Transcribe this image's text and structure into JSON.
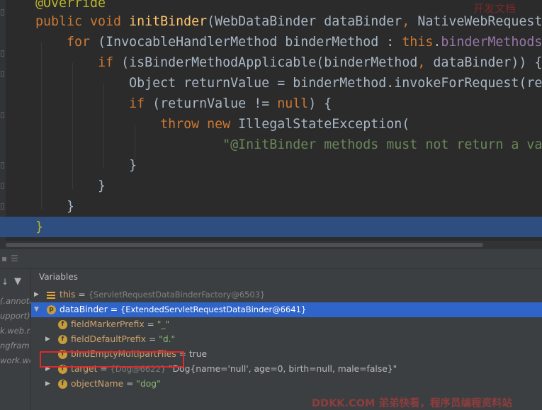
{
  "editor": {
    "lines": [
      {
        "segments": [
          {
            "t": "@Override",
            "c": "ann"
          }
        ]
      },
      {
        "segments": [
          {
            "t": "public void ",
            "c": "kw"
          },
          {
            "t": "initBinder",
            "c": "fn"
          },
          {
            "t": "(WebDataBinder dataBinder",
            "c": ""
          },
          {
            "t": ", ",
            "c": "kw"
          },
          {
            "t": "NativeWebRequest",
            "c": ""
          }
        ]
      },
      {
        "segments": [
          {
            "t": "    ",
            "c": ""
          },
          {
            "t": "for ",
            "c": "kw"
          },
          {
            "t": "(InvocableHandlerMethod binderMethod : ",
            "c": ""
          },
          {
            "t": "this",
            "c": "kw"
          },
          {
            "t": ".",
            "c": ""
          },
          {
            "t": "binderMethods",
            "c": "fld"
          }
        ]
      },
      {
        "segments": [
          {
            "t": "        ",
            "c": ""
          },
          {
            "t": "if ",
            "c": "kw"
          },
          {
            "t": "(isBinderMethodApplicable(binderMethod",
            "c": ""
          },
          {
            "t": ", ",
            "c": "kw"
          },
          {
            "t": "dataBinder)) {",
            "c": ""
          }
        ]
      },
      {
        "segments": [
          {
            "t": "            Object returnValue = binderMethod.invokeForRequest(re",
            "c": ""
          }
        ]
      },
      {
        "segments": [
          {
            "t": "            ",
            "c": ""
          },
          {
            "t": "if ",
            "c": "kw"
          },
          {
            "t": "(returnValue != ",
            "c": ""
          },
          {
            "t": "null",
            "c": "kw"
          },
          {
            "t": ") {",
            "c": ""
          }
        ]
      },
      {
        "segments": [
          {
            "t": "                ",
            "c": ""
          },
          {
            "t": "throw new ",
            "c": "kw"
          },
          {
            "t": "IllegalStateException(",
            "c": ""
          }
        ]
      },
      {
        "segments": [
          {
            "t": "                        ",
            "c": ""
          },
          {
            "t": "\"@InitBinder methods must not return a va",
            "c": "str"
          }
        ]
      },
      {
        "segments": [
          {
            "t": "            }",
            "c": ""
          }
        ]
      },
      {
        "segments": [
          {
            "t": "        }",
            "c": ""
          }
        ]
      },
      {
        "segments": [
          {
            "t": "    }",
            "c": ""
          }
        ]
      },
      {
        "segments": [
          {
            "t": "}",
            "c": "ann"
          }
        ]
      }
    ]
  },
  "debugger": {
    "variables_label": "Variables",
    "frames": [
      "(.annota",
      "upport)",
      "k.web.n",
      "ngfram",
      "work.we",
      ""
    ],
    "variables": [
      {
        "toggle": "▶",
        "icon": "list",
        "name": "this",
        "eq": " = ",
        "type": "{ServletRequestDataBinderFactory@6503}",
        "value": ""
      },
      {
        "toggle": "▼",
        "icon": "p",
        "name": "dataBinder",
        "eq": " = ",
        "type": "{ExtendedServletRequestDataBinder@6641}",
        "value": ""
      },
      {
        "toggle": "",
        "icon": "f",
        "name": "fieldMarkerPrefix",
        "eq": " = ",
        "type": "",
        "value": "\"_\""
      },
      {
        "toggle": "▶",
        "icon": "f",
        "name": "fieldDefaultPrefix",
        "eq": " = ",
        "type": "",
        "value": "\"d.\""
      },
      {
        "toggle": "",
        "icon": "f",
        "name": "bindEmptyMultipartFiles",
        "eq": " = ",
        "type": "",
        "value": "true"
      },
      {
        "toggle": "▶",
        "icon": "f",
        "name": "target",
        "eq": " = ",
        "type": "{Dog@6622}",
        "value": " \"Dog{name='null', age=0, birth=null, male=false}\""
      },
      {
        "toggle": "▶",
        "icon": "f",
        "name": "objectName",
        "eq": " = ",
        "type": "",
        "value": "\"dog\""
      }
    ]
  },
  "watermarks": {
    "top": "开发文档",
    "bottom": "DDKK.COM 弟弟快看，程序员编程资料站"
  },
  "colors": {
    "editor_bg": "#2b2b2b",
    "keyword": "#cc7832",
    "annotation": "#bbb529",
    "method": "#ffc66d",
    "field": "#9876aa",
    "string": "#6a8759",
    "selection": "#2f65ca",
    "highlight_box": "#e0292a"
  }
}
